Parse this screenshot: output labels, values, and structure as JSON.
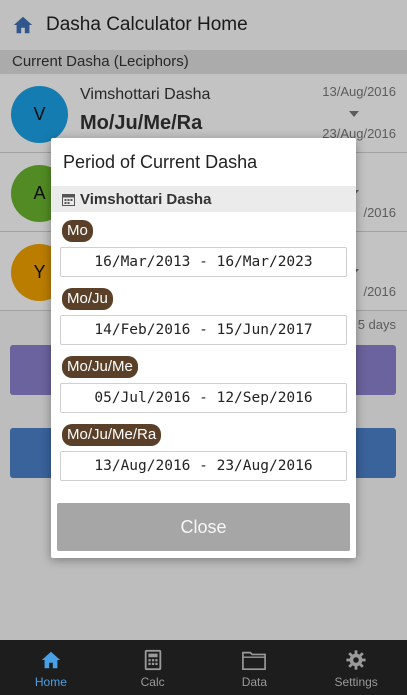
{
  "header": {
    "title": "Dasha Calculator Home"
  },
  "section": {
    "label": "Current Dasha (Leciphors)"
  },
  "rows": [
    {
      "letter": "V",
      "color": "#1a9fe3",
      "name": "Vimshottari Dasha",
      "lords": "Mo/Ju/Me/Ra",
      "start": "13/Aug/2016",
      "end": "23/Aug/2016"
    },
    {
      "letter": "A",
      "color": "#6ab22e",
      "name": "",
      "lords": "",
      "start": "",
      "end": "/2016"
    },
    {
      "letter": "Y",
      "color": "#f0a000",
      "name": "",
      "lords": "",
      "start": "",
      "end": "/2016"
    }
  ],
  "remaining": "5 days",
  "dialog": {
    "title": "Period of Current Dasha",
    "subtitle": "Vimshottari Dasha",
    "periods": [
      {
        "tag": "Mo",
        "range": "16/Mar/2013 - 16/Mar/2023"
      },
      {
        "tag": "Mo/Ju",
        "range": "14/Feb/2016 - 15/Jun/2017"
      },
      {
        "tag": "Mo/Ju/Me",
        "range": "05/Jul/2016 - 12/Sep/2016"
      },
      {
        "tag": "Mo/Ju/Me/Ra",
        "range": "13/Aug/2016 - 23/Aug/2016"
      }
    ],
    "close_label": "Close"
  },
  "tabs": [
    {
      "label": "Home",
      "icon": "home-icon",
      "active": true
    },
    {
      "label": "Calc",
      "icon": "calculator-icon",
      "active": false
    },
    {
      "label": "Data",
      "icon": "folder-icon",
      "active": false
    },
    {
      "label": "Settings",
      "icon": "gear-icon",
      "active": false
    }
  ],
  "colors": {
    "accent": "#4aa0e6",
    "tag_bg": "#5a4028",
    "button_purple": "#8a7fc9",
    "button_blue": "#4b7ec7"
  }
}
